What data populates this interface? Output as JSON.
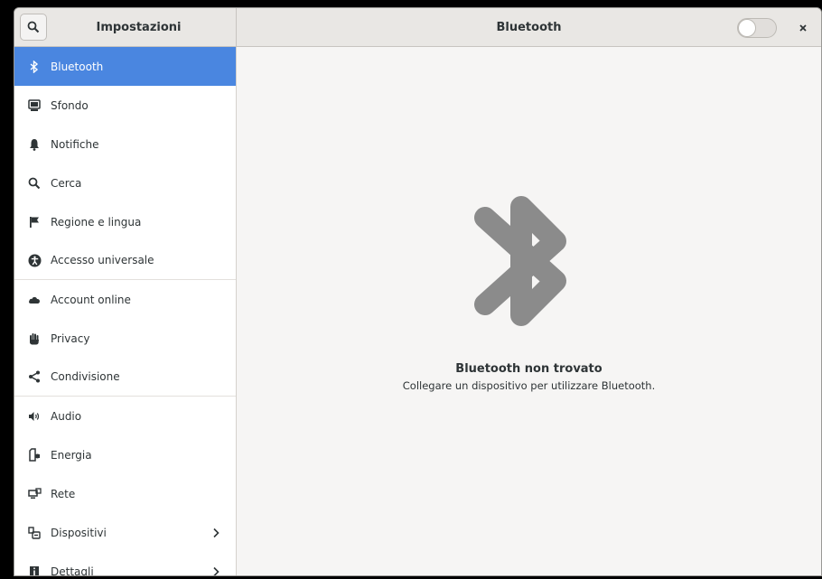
{
  "app": {
    "title": "Impostazioni"
  },
  "page": {
    "title": "Bluetooth",
    "toggle_on": false
  },
  "sidebar": {
    "items": [
      {
        "label": "Bluetooth",
        "icon": "bluetooth-icon",
        "active": true
      },
      {
        "label": "Sfondo",
        "icon": "background-icon"
      },
      {
        "label": "Notifiche",
        "icon": "bell-icon"
      },
      {
        "label": "Cerca",
        "icon": "search-icon"
      },
      {
        "label": "Regione e lingua",
        "icon": "flag-icon"
      },
      {
        "label": "Accesso universale",
        "icon": "accessibility-icon"
      },
      {
        "label": "Account online",
        "icon": "cloud-icon"
      },
      {
        "label": "Privacy",
        "icon": "hand-icon"
      },
      {
        "label": "Condivisione",
        "icon": "share-icon"
      },
      {
        "label": "Audio",
        "icon": "speaker-icon"
      },
      {
        "label": "Energia",
        "icon": "battery-icon"
      },
      {
        "label": "Rete",
        "icon": "network-icon"
      },
      {
        "label": "Dispositivi",
        "icon": "devices-icon",
        "has_submenu": true
      },
      {
        "label": "Dettagli",
        "icon": "info-icon",
        "has_submenu": true
      }
    ]
  },
  "empty_state": {
    "title": "Bluetooth non trovato",
    "subtitle": "Collegare un dispositivo per utilizzare Bluetooth."
  },
  "colors": {
    "accent": "#4a86e0",
    "icon": "#2e3436",
    "empty_icon": "#8b8b8b",
    "background": "#f6f5f4"
  }
}
